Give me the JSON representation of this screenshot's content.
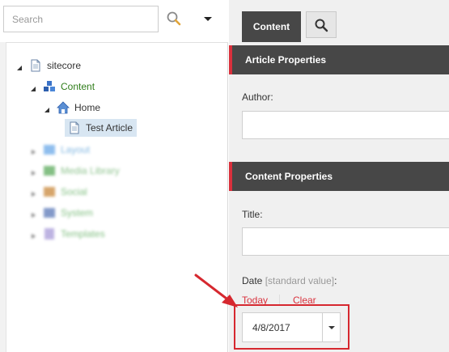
{
  "search": {
    "placeholder": "Search"
  },
  "tree": {
    "root": "sitecore",
    "content": "Content",
    "home": "Home",
    "selected_item": "Test Article",
    "blurred_items": [
      "Layout",
      "Media Library",
      "Social",
      "System",
      "Templates"
    ]
  },
  "tabs": {
    "content_label": "Content"
  },
  "sections": {
    "article": {
      "title": "Article Properties",
      "author_label": "Author:",
      "author_value": ""
    },
    "content": {
      "title": "Content Properties",
      "title_label": "Title:",
      "title_value": "",
      "date_label": "Date",
      "date_standard": "[standard value]",
      "date_colon": ":",
      "today_link": "Today",
      "clear_link": "Clear",
      "date_value": "4/8/2017"
    }
  },
  "colors": {
    "accent_red": "#d9303c",
    "header_dark": "#474747",
    "selection_blue": "#d8e6f2",
    "tree_green": "#2f7d1a"
  }
}
